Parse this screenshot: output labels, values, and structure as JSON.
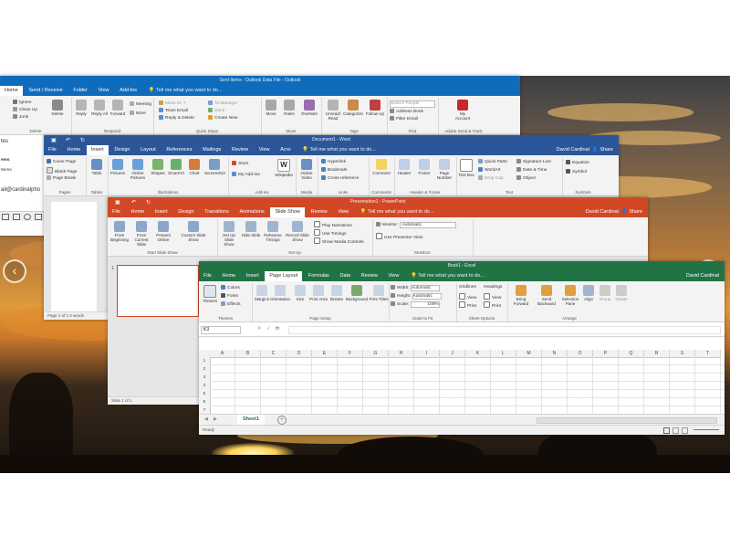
{
  "outlook": {
    "title": "Sent Items - Outlook Data File - Outlook",
    "tabs": [
      "Home",
      "Send / Receive",
      "Folder",
      "View",
      "Add-Ins"
    ],
    "tell": "Tell me what you want to do...",
    "buttons": {
      "ignore": "Ignore",
      "cleanup": "Clean Up",
      "junk": "Junk",
      "delete": "Delete",
      "reply": "Reply",
      "reply_all": "Reply All",
      "forward": "Forward",
      "meeting": "Meeting",
      "more": "More",
      "move_to": "Move to: ?",
      "team_email": "Team Email",
      "reply_delete": "Reply & Delete",
      "to_manager": "To Manager",
      "done": "Done",
      "create_new": "Create New",
      "move": "Move",
      "rules": "Rules",
      "onenote": "OneNote",
      "unread_read": "Unread/ Read",
      "categorize": "Categorize",
      "follow_up": "Follow Up",
      "search_people": "Search People",
      "address_book": "Address Book",
      "filter_email": "Filter Email",
      "my_account": "My Account"
    },
    "groups": [
      "Delete",
      "Respond",
      "Quick Steps",
      "Move",
      "Tags",
      "Find",
      "Adobe Send & Track"
    ],
    "side": [
      "tes",
      "ems",
      "Items",
      "ail@cardinalpho"
    ]
  },
  "word": {
    "title": "Document1 - Word",
    "tabs": [
      "File",
      "Home",
      "Insert",
      "Design",
      "Layout",
      "References",
      "Mailings",
      "Review",
      "View",
      "Acro"
    ],
    "active_tab": "Insert",
    "tell": "Tell me what you want to do...",
    "user": "David Cardinal",
    "share": "Share",
    "buttons": {
      "cover_page": "Cover Page",
      "blank_page": "Blank Page",
      "page_break": "Page Break",
      "table": "Table",
      "pictures": "Pictures",
      "online_pictures": "Online Pictures",
      "shapes": "Shapes",
      "smartart": "SmartArt",
      "chart": "Chart",
      "screenshot": "Screenshot",
      "store": "Store",
      "my_addins": "My Add-ins",
      "wikipedia": "Wikipedia",
      "online_video": "Online Video",
      "hyperlink": "Hyperlink",
      "bookmark": "Bookmark",
      "cross_reference": "Cross-reference",
      "comment": "Comment",
      "header": "Header",
      "footer": "Footer",
      "page_number": "Page Number",
      "text_box": "Text Box",
      "quick_parts": "Quick Parts",
      "wordart": "WordArt",
      "drop_cap": "Drop Cap",
      "signature_line": "Signature Line",
      "date_time": "Date & Time",
      "object": "Object",
      "equation": "Equation",
      "symbol": "Symbol"
    },
    "groups": [
      "Pages",
      "Tables",
      "Illustrations",
      "Add-ins",
      "Media",
      "Links",
      "Comments",
      "Header & Footer",
      "Text",
      "Symbols"
    ],
    "status": "Page 1 of 1   0 words"
  },
  "powerpoint": {
    "title": "Presentation1 - PowerPoint",
    "tabs": [
      "File",
      "Home",
      "Insert",
      "Design",
      "Transitions",
      "Animations",
      "Slide Show",
      "Review",
      "View"
    ],
    "active_tab": "Slide Show",
    "tell": "Tell me what you want to do...",
    "user": "David Cardinal",
    "share": "Share",
    "buttons": {
      "from_beginning": "From Beginning",
      "from_current": "From Current Slide",
      "present_online": "Present Online",
      "custom_slide_show": "Custom Slide Show",
      "set_up_slide_show": "Set Up Slide Show",
      "hide_slide": "Hide Slide",
      "rehearse_timings": "Rehearse Timings",
      "record_slide_show": "Record Slide Show",
      "play_narrations": "Play Narrations",
      "use_timings": "Use Timings",
      "show_media_controls": "Show Media Controls",
      "monitor_label": "Monitor:",
      "monitor_value": "Automatic",
      "use_presenter_view": "Use Presenter View"
    },
    "groups": [
      "Start Slide Show",
      "Set Up",
      "Monitors"
    ],
    "slide_number": "1",
    "status": "Slide 1 of 1"
  },
  "excel": {
    "title": "Book1 - Excel",
    "tabs": [
      "File",
      "Home",
      "Insert",
      "Page Layout",
      "Formulas",
      "Data",
      "Review",
      "View"
    ],
    "active_tab": "Page Layout",
    "tell": "Tell me what you want to do...",
    "user": "David Cardinal",
    "buttons": {
      "themes": "Themes",
      "colors": "Colors",
      "fonts": "Fonts",
      "effects": "Effects",
      "margins": "Margins",
      "orientation": "Orientation",
      "size": "Size",
      "print_area": "Print Area",
      "breaks": "Breaks",
      "background": "Background",
      "print_titles": "Print Titles",
      "width": "Width:",
      "width_val": "Automatic",
      "height": "Height:",
      "height_val": "Automatic",
      "scale": "Scale:",
      "scale_val": "100%",
      "gridlines": "Gridlines",
      "headings": "Headings",
      "view": "View",
      "print": "Print",
      "bring_forward": "Bring Forward",
      "send_backward": "Send Backward",
      "selection_pane": "Selection Pane",
      "align": "Align",
      "group": "Group",
      "rotate": "Rotate"
    },
    "groups": [
      "Themes",
      "Page Setup",
      "Scale to Fit",
      "Sheet Options",
      "Arrange"
    ],
    "name_box": "K3",
    "fx": "fx",
    "columns": [
      "A",
      "B",
      "C",
      "D",
      "E",
      "F",
      "G",
      "H",
      "I",
      "J",
      "K",
      "L",
      "M",
      "N",
      "O",
      "P",
      "Q",
      "R",
      "S",
      "T"
    ],
    "rows": [
      "1",
      "2",
      "3",
      "4",
      "5",
      "6",
      "7",
      "8",
      "9"
    ],
    "sheet_tab": "Sheet1",
    "status": "Ready"
  },
  "colors": {
    "outlook": "#0f6cbd",
    "word": "#2b579a",
    "powerpoint": "#d24726",
    "excel": "#217346"
  },
  "nav": {
    "prev": "‹",
    "next": "›"
  }
}
